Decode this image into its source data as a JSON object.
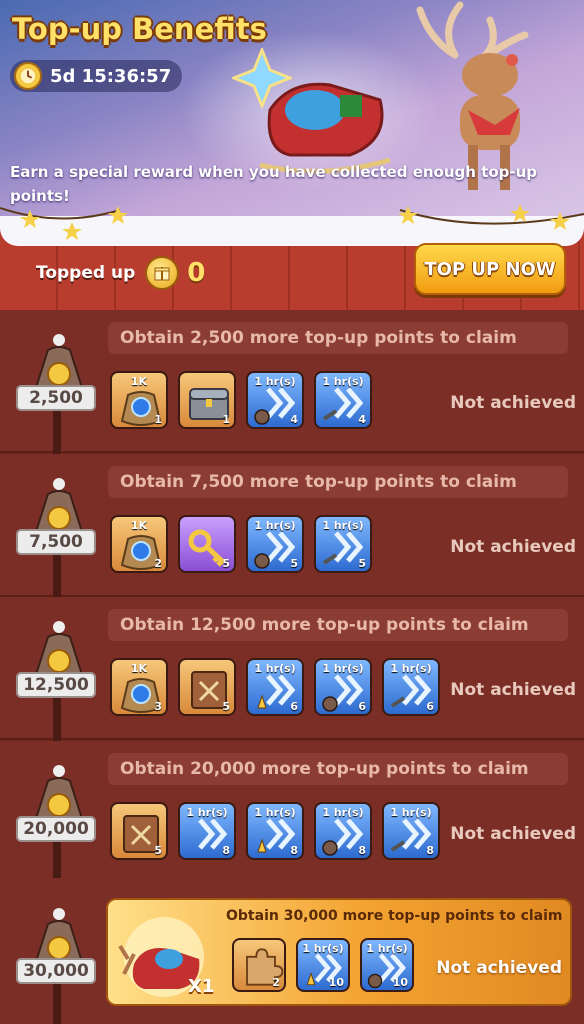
{
  "header": {
    "title": "Top-up Benefits",
    "timer": "5d 15:36:57",
    "description": "Earn a special reward when you have collected enough top-up points!"
  },
  "topup": {
    "label": "Topped up",
    "value": "0",
    "button": "TOP UP NOW"
  },
  "tiers": [
    {
      "points": "2,500",
      "requirement": "Obtain 2,500 more top-up points to claim",
      "status": "Not achieved",
      "items": [
        {
          "icon": "sapphire-bag-icon",
          "tag": "1K",
          "count": "1",
          "color": "orange"
        },
        {
          "icon": "treasure-chest-icon",
          "tag": "",
          "count": "1",
          "color": "orange"
        },
        {
          "icon": "speedup-training-icon",
          "tag": "1 hr(s)",
          "count": "4",
          "color": "blue"
        },
        {
          "icon": "speedup-building-icon",
          "tag": "1 hr(s)",
          "count": "4",
          "color": "blue"
        }
      ]
    },
    {
      "points": "7,500",
      "requirement": "Obtain 7,500 more top-up points to claim",
      "status": "Not achieved",
      "items": [
        {
          "icon": "sapphire-bag-icon",
          "tag": "1K",
          "count": "2",
          "color": "orange"
        },
        {
          "icon": "golden-key-icon",
          "tag": "",
          "count": "5",
          "color": "purple"
        },
        {
          "icon": "speedup-training-icon",
          "tag": "1 hr(s)",
          "count": "5",
          "color": "blue"
        },
        {
          "icon": "speedup-building-icon",
          "tag": "1 hr(s)",
          "count": "5",
          "color": "blue"
        }
      ]
    },
    {
      "points": "12,500",
      "requirement": "Obtain 12,500 more top-up points to claim",
      "status": "Not achieved",
      "items": [
        {
          "icon": "sapphire-bag-icon",
          "tag": "1K",
          "count": "3",
          "color": "orange"
        },
        {
          "icon": "skill-book-icon",
          "tag": "",
          "count": "5",
          "color": "orange"
        },
        {
          "icon": "speedup-research-icon",
          "tag": "1 hr(s)",
          "count": "6",
          "color": "blue"
        },
        {
          "icon": "speedup-training-icon",
          "tag": "1 hr(s)",
          "count": "6",
          "color": "blue"
        },
        {
          "icon": "speedup-building-icon",
          "tag": "1 hr(s)",
          "count": "6",
          "color": "blue"
        }
      ]
    },
    {
      "points": "20,000",
      "requirement": "Obtain 20,000 more top-up points to claim",
      "status": "Not achieved",
      "items": [
        {
          "icon": "skill-book-icon",
          "tag": "",
          "count": "5",
          "color": "orange"
        },
        {
          "icon": "speedup-general-icon",
          "tag": "1 hr(s)",
          "count": "8",
          "color": "blue"
        },
        {
          "icon": "speedup-research-icon",
          "tag": "1 hr(s)",
          "count": "8",
          "color": "blue"
        },
        {
          "icon": "speedup-training-icon",
          "tag": "1 hr(s)",
          "count": "8",
          "color": "blue"
        },
        {
          "icon": "speedup-building-icon",
          "tag": "1 hr(s)",
          "count": "8",
          "color": "blue"
        }
      ]
    }
  ],
  "final": {
    "points": "30,000",
    "requirement": "Obtain 30,000 more top-up points to claim",
    "status": "Not achieved",
    "reward_qty": "X1",
    "reward_icon": "reindeer-sleigh-icon",
    "items": [
      {
        "icon": "puzzle-piece-icon",
        "tag": "",
        "count": "2",
        "color": "orange"
      },
      {
        "icon": "speedup-research-icon",
        "tag": "1 hr(s)",
        "count": "10",
        "color": "blue"
      },
      {
        "icon": "speedup-training-icon",
        "tag": "1 hr(s)",
        "count": "10",
        "color": "blue"
      }
    ]
  }
}
